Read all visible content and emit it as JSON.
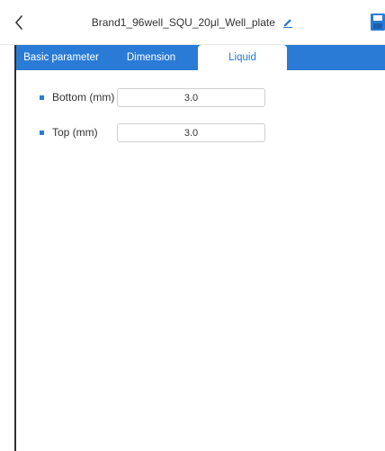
{
  "header": {
    "back_icon": "chevron-left-icon",
    "title": "Brand1_96well_SQU_20μl_Well_plate",
    "edit_icon": "pencil-icon",
    "save_icon": "floppy-disk-icon"
  },
  "tabs": [
    {
      "label": "Basic parameter",
      "active": false
    },
    {
      "label": "Dimension",
      "active": false
    },
    {
      "label": "Liquid",
      "active": true
    }
  ],
  "liquid": {
    "bottom": {
      "label": "Bottom (mm)",
      "value": "3.0"
    },
    "top": {
      "label": "Top (mm)",
      "value": "3.0"
    }
  },
  "colors": {
    "accent": "#2a7bd6",
    "active_tab_text": "#1f78d1",
    "text": "#333333",
    "field_border": "#cfcfcf"
  }
}
